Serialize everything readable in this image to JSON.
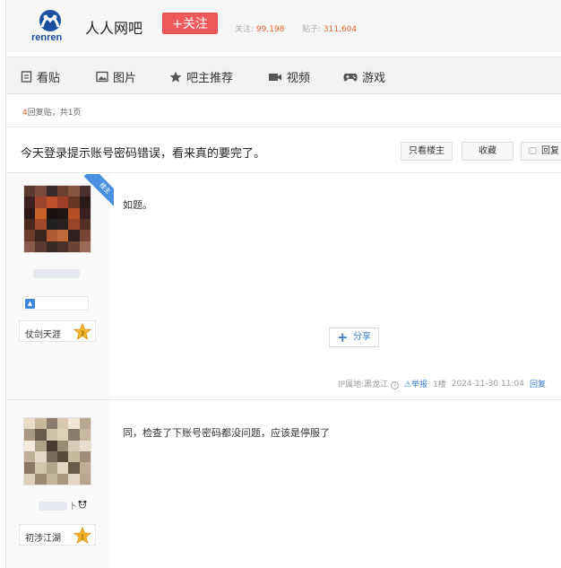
{
  "header": {
    "logo_text": "renren",
    "forum_name": "人人网吧",
    "follow_label": "+关注",
    "follow_count_label": "关注:",
    "follow_count": "99,198",
    "post_count_label": "贴子:",
    "post_count": "311,604"
  },
  "nav": {
    "items": [
      {
        "label": "看贴",
        "icon": "document-icon"
      },
      {
        "label": "图片",
        "icon": "image-icon"
      },
      {
        "label": "吧主推荐",
        "icon": "star-icon"
      },
      {
        "label": "视频",
        "icon": "video-icon"
      },
      {
        "label": "游戏",
        "icon": "gamepad-icon"
      }
    ]
  },
  "thread": {
    "reply_count": "4",
    "reply_summary_suffix": "回复贴，共1页",
    "title": "今天登录提示账号密码错误，看来真的要完了。",
    "buttons": {
      "only_op": "只看楼主",
      "favorite": "收藏",
      "reply": "回复"
    }
  },
  "posts": [
    {
      "badge": "楼主",
      "rank_name": "仗剑天涯",
      "rank_level": "3",
      "content": "如题。",
      "share_label": "分享",
      "ip_location": "IP属地:黑龙江",
      "report_label": "举报",
      "floor": "1楼",
      "time": "2024-11-30 11:04",
      "reply_label": "回复"
    },
    {
      "user_suffix": "卜",
      "rank_name": "初涉江湖",
      "rank_level": "1",
      "content": "同，检查了下账号密码都没问题，应该是停服了"
    }
  ],
  "colors": {
    "accent_red": "#f05a5a",
    "link_blue": "#3b7cd4",
    "count_orange": "#e8622e"
  }
}
